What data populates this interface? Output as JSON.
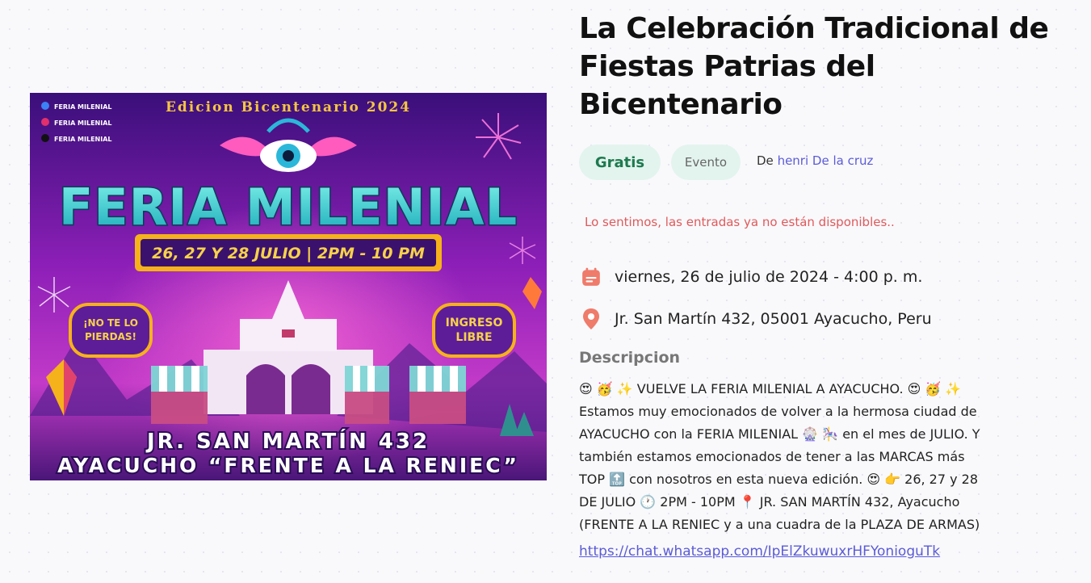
{
  "event": {
    "title": "La Celebración Tradicional de Fiestas Patrias del Bicentenario",
    "price_badge": "Gratis",
    "type_badge": "Evento",
    "organizer_prefix": "De",
    "organizer_name": "henri De la cruz",
    "soldout_message": "Lo sentimos, las entradas ya no están disponibles..",
    "date_text": "viernes, 26 de julio de 2024 - 4:00 p. m.",
    "location_text": "Jr. San Martín 432, 05001 Ayacucho, Peru",
    "description_heading": "Descripcion",
    "description_lines": [
      "😍 🥳 ✨ VUELVE LA FERIA MILENIAL A AYACUCHO. 😍 🥳 ✨",
      "Estamos muy emocionados de volver a la hermosa ciudad de",
      "AYACUCHO con la FERIA MILENIAL 🎡 🎠 en el mes de JULIO. Y",
      "también estamos emocionados de tener a las MARCAS más",
      "TOP 🔝 con nosotros en esta nueva edición. 😍 👉 26, 27 y 28",
      "DE JULIO 🕐 2PM - 10PM 📍 JR. SAN MARTÍN 432, Ayacucho",
      "(FRENTE A LA RENIEC y a una cuadra de la PLAZA DE ARMAS)"
    ],
    "whatsapp_link": "https://chat.whatsapp.com/IpElZkuwuxrHFYonioguTk"
  },
  "poster": {
    "edition": "Edicion Bicentenario 2024",
    "social_1": "FERIA MILENIAL",
    "social_2": "FERIA MILENIAL",
    "social_3": "FERIA MILENIAL",
    "headline": "FERIA MILENIAL",
    "dates": "26, 27 Y 28 JULIO | 2PM - 10 PM",
    "left_badge_1": "¡NO TE LO",
    "left_badge_2": "PIERDAS!",
    "right_badge_1": "INGRESO",
    "right_badge_2": "LIBRE",
    "address_1": "JR. SAN MARTÍN 432",
    "address_2": "AYACUCHO “FRENTE A LA RENIEC”"
  },
  "icons": {
    "calendar": "calendar-icon",
    "location": "map-pin-icon"
  },
  "colors": {
    "accent": "#5b5bd6",
    "badge_bg": "#e3f4ee",
    "free_text": "#1e7a4f",
    "error": "#e05a5a",
    "icon_coral": "#ef7b6b"
  }
}
